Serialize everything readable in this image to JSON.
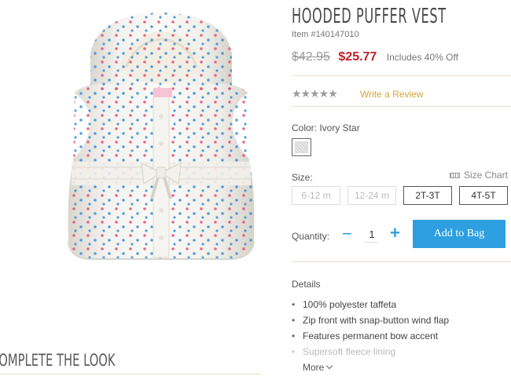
{
  "product": {
    "title": "HOODED PUFFER VEST",
    "item_number": "Item #140147010",
    "original_price": "$42.95",
    "sale_price": "$25.77",
    "discount_note": "Includes 40% Off",
    "stars": "★★★★★",
    "write_review_label": "Write a Review",
    "image_icon": "hooded-puffer-vest-image"
  },
  "color": {
    "label": "Color: Ivory Star",
    "swatch_icon": "ivory-star-swatch"
  },
  "size": {
    "label": "Size:",
    "chart_label": "Size Chart",
    "chart_icon": "ruler-icon",
    "options": [
      {
        "label": "6-12 m",
        "available": false
      },
      {
        "label": "12-24 m",
        "available": false
      },
      {
        "label": "2T-3T",
        "available": true
      },
      {
        "label": "4T-5T",
        "available": true
      }
    ]
  },
  "quantity": {
    "label": "Quantity:",
    "minus": "−",
    "value": "1",
    "plus": "+"
  },
  "add_to_bag_label": "Add to Bag",
  "details": {
    "title": "Details",
    "items": [
      "100% polyester taffeta",
      "Zip front with snap-button wind flap",
      "Features permanent bow accent",
      "Supersoft fleece lining"
    ],
    "more_label": "More"
  },
  "complete_the_look": "COMPLETE THE LOOK",
  "colors": {
    "accent_blue": "#2d9fe0",
    "sale_red": "#c0212a",
    "review_gold": "#d8a43c"
  }
}
